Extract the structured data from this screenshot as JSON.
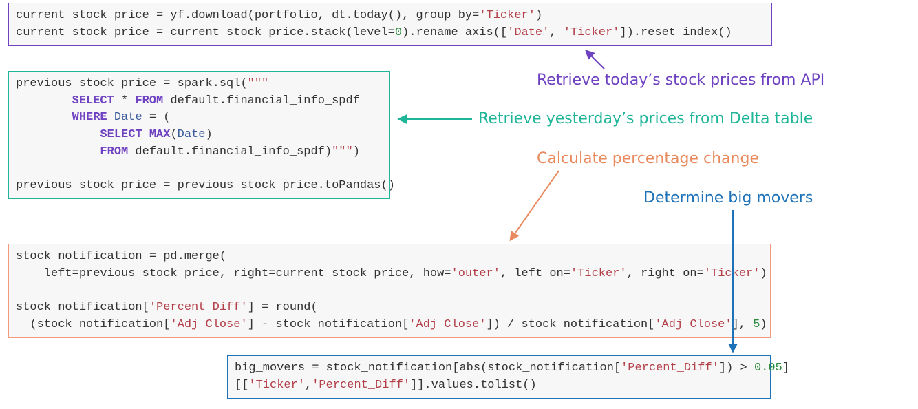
{
  "blocks": {
    "purple": "current_stock_price = yf.download(portfolio, dt.today(), group_by=<span class=\"s\">'Ticker'</span>)\ncurrent_stock_price = current_stock_price.stack(level=<span class=\"num\">0</span>).rename_axis([<span class=\"s\">'Date'</span>, <span class=\"s\">'Ticker'</span>]).reset_index()",
    "teal": "previous_stock_price = spark.sql(<span class=\"s\">\"\"\"</span>\n        <span class=\"sb\">SELECT</span> * <span class=\"sb\">FROM</span> default.financial_info_spdf\n        <span class=\"sb\">WHERE</span> <span class=\"id\">Date</span> = (\n            <span class=\"sb\">SELECT</span> <span class=\"sb\">MAX</span>(<span class=\"id\">Date</span>)\n            <span class=\"sb\">FROM</span> default.financial_info_spdf)<span class=\"s\">\"\"\"</span>)\n\nprevious_stock_price = previous_stock_price.toPandas()",
    "coral": "stock_notification = pd.merge(\n    left=previous_stock_price, right=current_stock_price, how=<span class=\"s\">'outer'</span>, left_on=<span class=\"s\">'Ticker'</span>, right_on=<span class=\"s\">'Ticker'</span>)\n\nstock_notification[<span class=\"s\">'Percent_Diff'</span>] = round(\n  (stock_notification[<span class=\"s\">'Adj Close'</span>] - stock_notification[<span class=\"s\">'Adj_Close'</span>]) / stock_notification[<span class=\"s\">'Adj Close'</span>], <span class=\"num\">5</span>)",
    "blue": "big_movers = stock_notification[abs(stock_notification[<span class=\"s\">'Percent_Diff'</span>]) > <span class=\"num\">0.05</span>]\n[[<span class=\"s\">'Ticker'</span>,<span class=\"s\">'Percent_Diff'</span>]].values.tolist()"
  },
  "labels": {
    "purple": "Retrieve today’s stock prices from API",
    "teal": "Retrieve yesterday’s prices from Delta table",
    "coral": "Calculate percentage change",
    "blue": "Determine big movers"
  },
  "colors": {
    "purple": "#6f42c1",
    "teal": "#1fb598",
    "coral": "#e88a5e",
    "blue": "#1d72b8"
  }
}
